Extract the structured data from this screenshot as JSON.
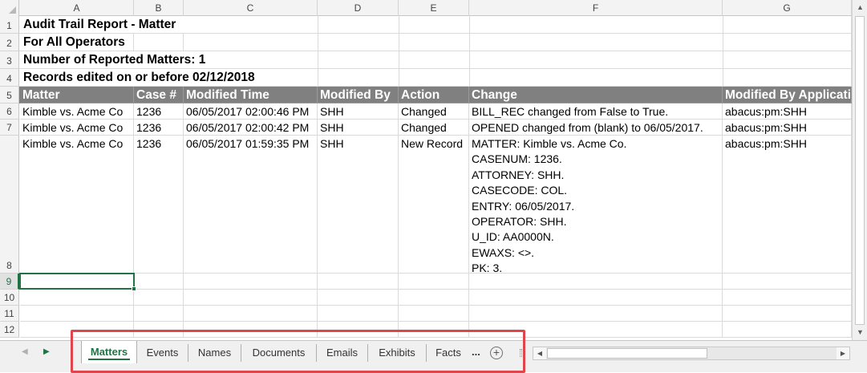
{
  "columns": [
    "A",
    "B",
    "C",
    "D",
    "E",
    "F",
    "G"
  ],
  "row_numbers": [
    "1",
    "2",
    "3",
    "4",
    "5",
    "6",
    "7",
    "8",
    "9",
    "10",
    "11",
    "12"
  ],
  "report": {
    "title": "Audit Trail Report - Matter",
    "operators": "For All Operators",
    "count": "Number of Reported Matters: 1",
    "edited": "Records edited on or before 02/12/2018"
  },
  "table_header": {
    "matter": "Matter",
    "case": "Case #",
    "time": "Modified Time",
    "by": "Modified By",
    "action": "Action",
    "change": "Change",
    "app": "Modified By Application"
  },
  "rows": [
    {
      "matter": "Kimble vs. Acme Co",
      "case": "1236",
      "time": "06/05/2017 02:00:46 PM",
      "by": "SHH",
      "action": "Changed",
      "change": "BILL_REC changed from False to True.",
      "app": "abacus:pm:SHH"
    },
    {
      "matter": "Kimble vs. Acme Co",
      "case": "1236",
      "time": "06/05/2017 02:00:42 PM",
      "by": "SHH",
      "action": "Changed",
      "change": "OPENED changed from (blank) to 06/05/2017.",
      "app": "abacus:pm:SHH"
    },
    {
      "matter": "Kimble vs. Acme Co",
      "case": "1236",
      "time": "06/05/2017 01:59:35 PM",
      "by": "SHH",
      "action": "New Record",
      "change_lines": [
        "MATTER: Kimble vs. Acme Co.",
        "CASENUM: 1236.",
        "ATTORNEY: SHH.",
        "CASECODE: COL.",
        "ENTRY: 06/05/2017.",
        "OPERATOR: SHH.",
        "U_ID: AA0000N.",
        "EWAXS: <>.",
        "PK: 3."
      ],
      "app": "abacus:pm:SHH"
    }
  ],
  "sheet_tabs": [
    "Matters",
    "Events",
    "Names",
    "Documents",
    "Emails",
    "Exhibits",
    "Facts"
  ],
  "active_tab": "Matters",
  "more_tabs": "...",
  "add_sheet": "+",
  "colors": {
    "accent": "#217346",
    "header_band": "#808080",
    "highlight_box": "#e0454b"
  }
}
